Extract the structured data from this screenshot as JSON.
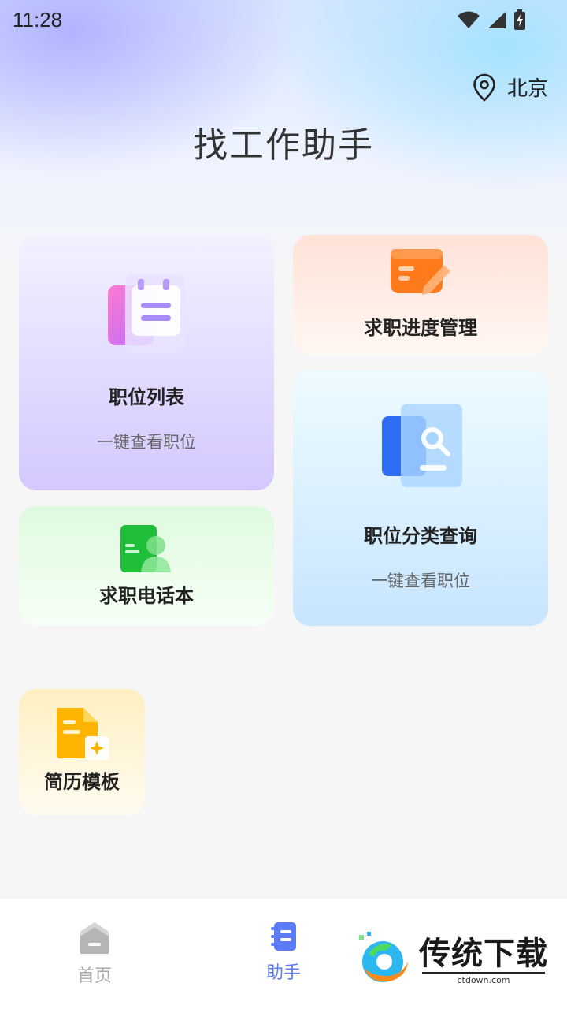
{
  "status": {
    "time": "11:28"
  },
  "location": {
    "city": "北京"
  },
  "title": "找工作助手",
  "cards": {
    "positions": {
      "title": "职位列表",
      "subtitle": "一键查看职位"
    },
    "progress": {
      "title": "求职进度管理"
    },
    "phone": {
      "title": "求职电话本"
    },
    "category": {
      "title": "职位分类查询",
      "subtitle": "一键查看职位"
    },
    "resume": {
      "title": "简历模板"
    }
  },
  "nav": {
    "home": "首页",
    "assistant": "助手"
  },
  "watermark": {
    "text": "传统下载",
    "sub": "ctdown.com"
  },
  "colors": {
    "accent": "#5b7cf5",
    "inactive": "#aaaaaa"
  }
}
